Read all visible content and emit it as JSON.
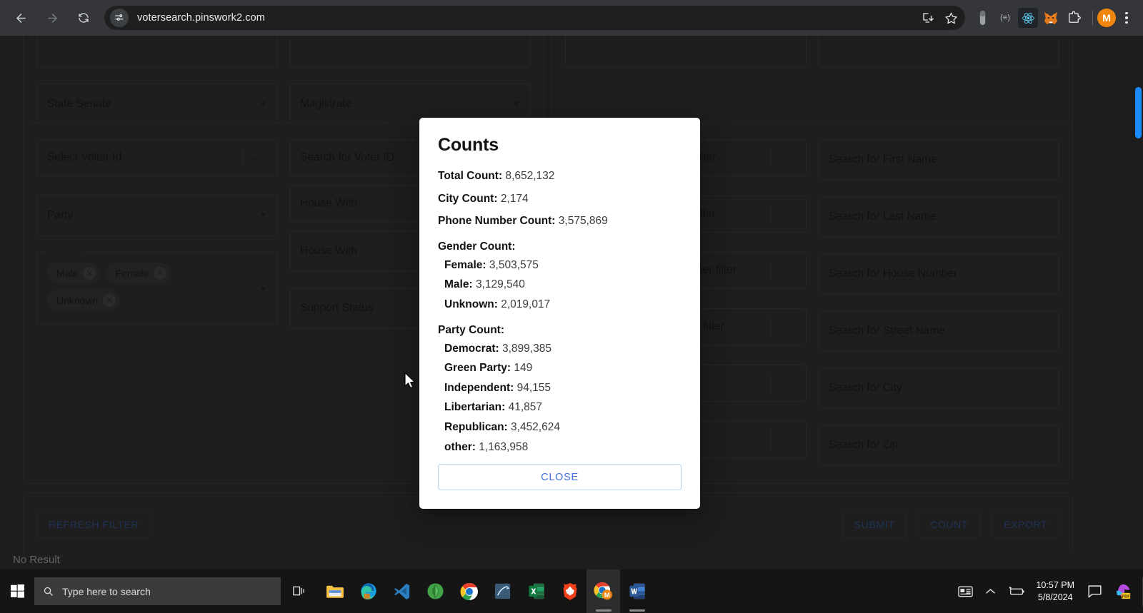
{
  "browser": {
    "back_icon": "back-arrow-icon",
    "forward_icon": "forward-arrow-icon",
    "reload_icon": "reload-icon",
    "url": "votersearch.pinswork2.com",
    "site_info_icon": "site-settings-icon",
    "install_icon": "install-app-icon",
    "bookmark_icon": "bookmark-star-icon",
    "extensions": [
      {
        "name": "capsule-extension-icon",
        "glyph": ""
      },
      {
        "name": "equalizer-extension-icon",
        "glyph": "(≡)"
      },
      {
        "name": "react-devtools-icon",
        "glyph": ""
      },
      {
        "name": "metamask-fox-icon",
        "glyph": ""
      },
      {
        "name": "extensions-puzzle-icon",
        "glyph": ""
      }
    ],
    "profile_initial": "M",
    "menu_icon": "kebab-menu-icon"
  },
  "page": {
    "left_column": {
      "top_panel": {
        "hidden_row_note": "",
        "selects": [
          {
            "label": "State Senate",
            "caret": "▼"
          },
          {
            "label": "Magistrate",
            "caret": "▼"
          }
        ]
      },
      "filters_panel": {
        "voter_id_select": {
          "label": "Select Volter Id",
          "caret": "⌄"
        },
        "party_select": {
          "label": "Party",
          "caret": "▼"
        },
        "gender_fieldset": {
          "legend": "Gender",
          "chips": [
            {
              "label": "Male",
              "remove_icon": "✕"
            },
            {
              "label": "Female",
              "remove_icon": "✕"
            },
            {
              "label": "Unknown",
              "remove_icon": "✕"
            }
          ],
          "caret": "▼"
        },
        "text_fields": [
          {
            "placeholder": "Search for Voter ID"
          },
          {
            "placeholder": "House With"
          },
          {
            "placeholder": "House With"
          },
          {
            "placeholder": "Support Status"
          }
        ]
      }
    },
    "right_column": {
      "filter_selects": [
        {
          "label": "Begins With First Name filter",
          "caret": "⌄"
        },
        {
          "label": "Begins With Last Name filter",
          "caret": "⌄"
        },
        {
          "label": "Begins With House Number filter",
          "caret": "⌄"
        },
        {
          "label": "Begins With Street Name filter",
          "caret": "⌄"
        },
        {
          "label": "",
          "caret": "⌄"
        },
        {
          "label": "",
          "caret": "⌄"
        }
      ],
      "search_fields": [
        {
          "placeholder": "Search for First Name"
        },
        {
          "placeholder": "Search for Last Name"
        },
        {
          "placeholder": "Search for House Number"
        },
        {
          "placeholder": "Search for Street Name"
        },
        {
          "placeholder": "Search for City"
        },
        {
          "placeholder": "Search for Zip"
        }
      ]
    },
    "actions": {
      "refresh": "REFRESH FILTER",
      "submit": "SUBMIT",
      "count": "COUNT",
      "export": "EXPORT"
    },
    "no_result": "No Result"
  },
  "modal": {
    "title": "Counts",
    "lines": [
      {
        "label": "Total Count:",
        "value": "8,652,132"
      },
      {
        "label": "City Count:",
        "value": "2,174"
      },
      {
        "label": "Phone Number Count:",
        "value": "3,575,869"
      }
    ],
    "gender": {
      "heading": "Gender Count:",
      "items": [
        {
          "label": "Female:",
          "value": "3,503,575"
        },
        {
          "label": "Male:",
          "value": "3,129,540"
        },
        {
          "label": "Unknown:",
          "value": "2,019,017"
        }
      ]
    },
    "party": {
      "heading": "Party Count:",
      "items": [
        {
          "label": "Democrat:",
          "value": "3,899,385"
        },
        {
          "label": "Green Party:",
          "value": "149"
        },
        {
          "label": "Independent:",
          "value": "94,155"
        },
        {
          "label": "Libertarian:",
          "value": "41,857"
        },
        {
          "label": "Republican:",
          "value": "3,452,624"
        },
        {
          "label": "other:",
          "value": "1,163,958"
        }
      ]
    },
    "close_label": "CLOSE"
  },
  "taskbar": {
    "start_icon": "windows-start-icon",
    "search_placeholder": "Type here to search",
    "search_icon": "search-icon",
    "task_view_icon": "task-view-icon",
    "apps": [
      {
        "name": "file-explorer-icon"
      },
      {
        "name": "microsoft-edge-icon"
      },
      {
        "name": "vscode-icon"
      },
      {
        "name": "mongodb-compass-icon"
      },
      {
        "name": "google-chrome-icon"
      },
      {
        "name": "sql-server-management-studio-icon"
      },
      {
        "name": "microsoft-excel-icon"
      },
      {
        "name": "brave-browser-icon"
      },
      {
        "name": "chrome-metamask-icon"
      },
      {
        "name": "microsoft-word-icon"
      }
    ],
    "tray": {
      "news_icon": "news-and-interests-icon",
      "chevron_icon": "show-hidden-icons-icon",
      "battery_icon": "battery-charging-icon",
      "time": "10:57 PM",
      "date": "5/8/2024",
      "action_center_icon": "action-center-icon",
      "pde_icon": "pdf-tool-icon"
    }
  },
  "colors": {
    "accent_blue": "#1a8cff",
    "modal_link": "#3f6fd8",
    "avatar_orange": "#f0860d"
  }
}
